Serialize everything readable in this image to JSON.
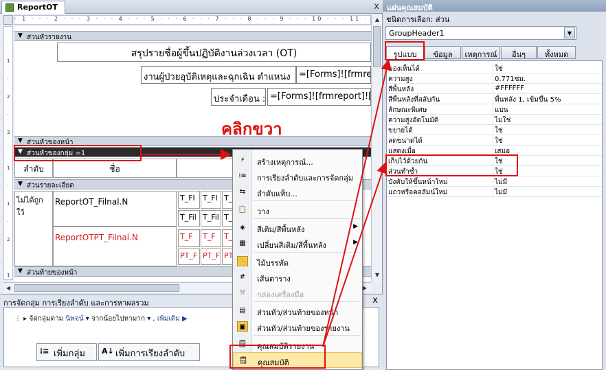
{
  "document": {
    "tab_label": "ReportOT",
    "close_label": "x"
  },
  "ruler": {
    "marks": "· 1 · · · 2 · · · 3 · · · 4 · · · 5 · · · 6 · · · 7 · · · 8 · · · 9 · · · 10 · · · 11 · · · 12 · · · 13 · · · 14 · · · 15 ·",
    "vertical_marks": [
      "·",
      "1",
      "·",
      "2",
      "·",
      "3",
      "·",
      "1",
      "·",
      "1",
      "·",
      "2",
      "·",
      "1"
    ]
  },
  "sections": {
    "report_header": "ส่วนหัวรายงาน",
    "page_header": "ส่วนหัวของหน้า",
    "group_header": "ส่วนหัวของกลุ่ม =1",
    "detail": "ส่วนรายละเอียด",
    "page_footer": "ส่วนท้ายของหน้า"
  },
  "report_header": {
    "title": "สรุปรายชื่อผู้ขึ้นปฏิบัติงานล่วงเวลา (OT)",
    "subtitle_label": "งานผู้ป่วยอุบัติเหตุและฉุกเฉิน  ตำแหน่ง",
    "subtitle_field": "=[Forms]![frmre",
    "month_label": "ประจำเดือน :",
    "month_field": "=[Forms]![frmreport]![",
    "group_col1": "ลำดับ",
    "group_col2": "ชื่อ"
  },
  "detail": {
    "seq_label": "ไม่ได้ถูกใว้",
    "name_field1": "ReportOT_Filnal.N",
    "name_field2": "ReportOTPT_Filnal.N",
    "tfield": "T_FI",
    "tfield2": "T_Fil",
    "tfield_red": "T_F",
    "tfield_red2": "PT_F"
  },
  "annotation": {
    "right_click_text": "คลิกขวา"
  },
  "context_menu": {
    "items": [
      {
        "label": "สร้างเหตุการณ์...",
        "icon": "event-icon"
      },
      {
        "label": "การเรียงลำดับและการจัดกลุ่ม",
        "icon": "sort-group-icon"
      },
      {
        "label": "ลำดับแท็บ...",
        "icon": "tab-order-icon"
      },
      {
        "label": "วาง",
        "icon": "paste-icon"
      },
      {
        "label": "สีเติม/สีพื้นหลัง",
        "icon": "fill-color-icon"
      },
      {
        "label": "เปลี่ยนสีเติม/สีพื้นหลัง",
        "icon": "alt-fill-icon"
      },
      {
        "label": "ไม้บรรทัด",
        "icon": "ruler-icon"
      },
      {
        "label": "เส้นตาราง",
        "icon": "grid-icon"
      },
      {
        "label": "กล่องเครื่องมือ",
        "icon": "toolbox-icon"
      },
      {
        "label": "ส่วนหัว/ส่วนท้ายของหน้า",
        "icon": "page-header-icon"
      },
      {
        "label": "ส่วนหัว/ส่วนท้ายของรายงาน",
        "icon": "report-header-icon"
      },
      {
        "label": "คุณสมบัติรายงาน",
        "icon": "report-properties-icon"
      },
      {
        "label": "คุณสมบัติ",
        "icon": "properties-icon"
      }
    ]
  },
  "group_pane": {
    "title": "การจัดกลุ่ม การเรียงลำดับ และการหาผลรวม",
    "close_label": "x",
    "group_line_prefix": "จัดกลุ่มตาม",
    "group_field": "นิพจน์",
    "sort_order": "จากน้อยไปหามาก",
    "more": "เพิ่มเติม ▶",
    "add_group": "เพิ่มกลุ่ม",
    "add_sort": "เพิ่มการเรียงลำดับ"
  },
  "property_sheet": {
    "title": "แผ่นคุณสมบัติ",
    "selection_label": "ชนิดการเลือก:  ส่วน",
    "selected_object": "GroupHeader1",
    "tabs": [
      "รูปแบบ",
      "ข้อมูล",
      "เหตุการณ์",
      "อื่นๆ",
      "ทั้งหมด"
    ],
    "rows": [
      {
        "name": "มองเห็นได้",
        "value": "ใช่"
      },
      {
        "name": "ความสูง",
        "value": "0.771ซม."
      },
      {
        "name": "สีพื้นหลัง",
        "value": "#FFFFFF"
      },
      {
        "name": "สีพื้นหลังที่สลับกัน",
        "value": "พื้นหลัง 1, เข้มขึ้น 5%"
      },
      {
        "name": "ลักษณะพิเศษ",
        "value": "แบน"
      },
      {
        "name": "ความสูงอัตโนมัติ",
        "value": "ไม่ใช่"
      },
      {
        "name": "ขยายได้",
        "value": "ใช่"
      },
      {
        "name": "ลดขนาดได้",
        "value": "ใช่"
      },
      {
        "name": "แสดงเมื่อ",
        "value": "เสมอ"
      },
      {
        "name": "เก็บไว้ด้วยกัน",
        "value": "ใช่"
      },
      {
        "name": "ส่วนทำซ้ำ",
        "value": "ใช่"
      },
      {
        "name": "บังคับให้ขึ้นหน้าใหม่",
        "value": "ไม่มี"
      },
      {
        "name": "แถวหรือคอลัมน์ใหม่",
        "value": "ไม่มี"
      }
    ]
  },
  "colors": {
    "annotation_red": "#e01010",
    "group_header_bar": "#2b2b2b"
  }
}
